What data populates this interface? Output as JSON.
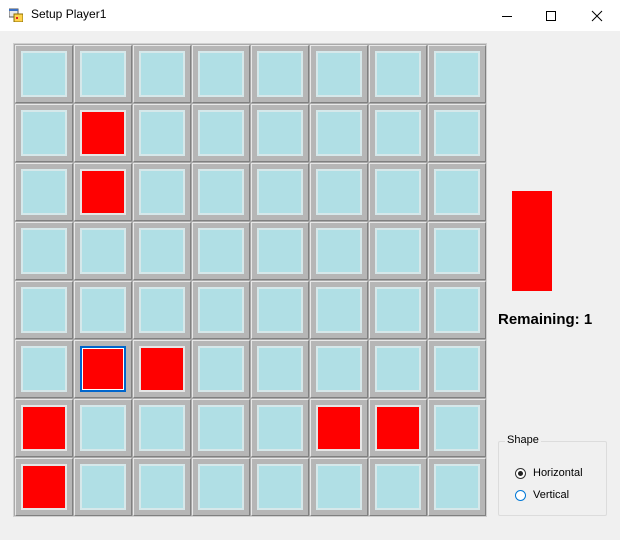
{
  "window": {
    "title": "Setup Player1",
    "icons": [
      "app-icon",
      "minimize-icon",
      "maximize-icon",
      "close-icon"
    ]
  },
  "colors": {
    "water": "#b0dfe5",
    "ship": "#ff0000",
    "selected_border": "#0066cc"
  },
  "board": {
    "rows": 8,
    "cols": 8,
    "cells": [
      [
        "water",
        "water",
        "water",
        "water",
        "water",
        "water",
        "water",
        "water"
      ],
      [
        "water",
        "ship",
        "water",
        "water",
        "water",
        "water",
        "water",
        "water"
      ],
      [
        "water",
        "ship",
        "water",
        "water",
        "water",
        "water",
        "water",
        "water"
      ],
      [
        "water",
        "water",
        "water",
        "water",
        "water",
        "water",
        "water",
        "water"
      ],
      [
        "water",
        "water",
        "water",
        "water",
        "water",
        "water",
        "water",
        "water"
      ],
      [
        "water",
        "ship",
        "ship",
        "water",
        "water",
        "water",
        "water",
        "water"
      ],
      [
        "ship",
        "water",
        "water",
        "water",
        "water",
        "ship",
        "ship",
        "water"
      ],
      [
        "ship",
        "water",
        "water",
        "water",
        "water",
        "water",
        "water",
        "water"
      ]
    ],
    "selected": {
      "row": 5,
      "col": 1
    }
  },
  "preview": {
    "orientation": "vertical"
  },
  "remaining": {
    "label": "Remaining: 1"
  },
  "shape": {
    "legend": "Shape",
    "options": [
      {
        "label": "Horizontal",
        "checked": true
      },
      {
        "label": "Vertical",
        "checked": false
      }
    ]
  }
}
